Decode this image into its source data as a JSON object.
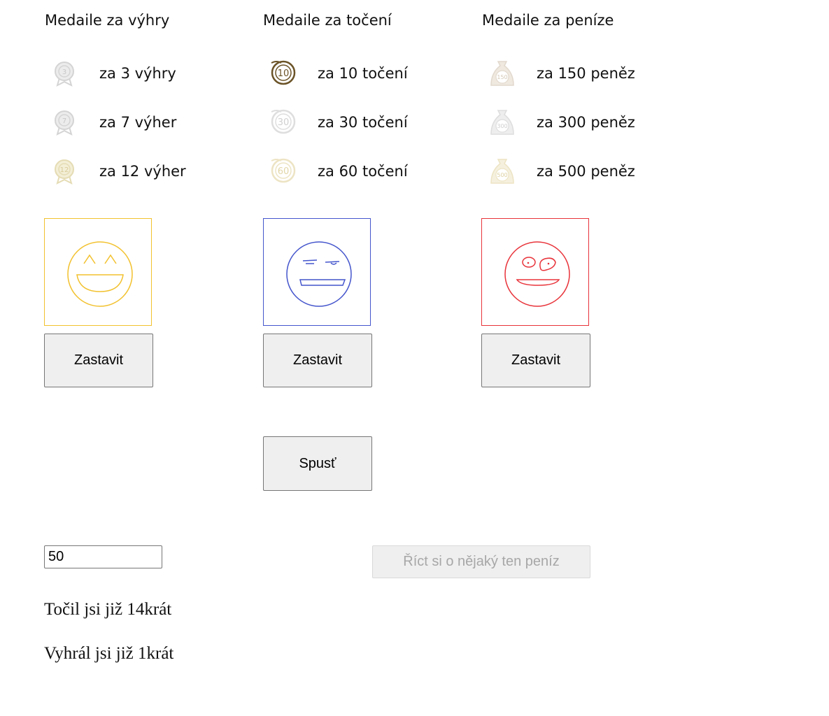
{
  "columns": [
    {
      "title": "Medaile za výhry",
      "medals": [
        {
          "badge": "3",
          "label": "za 3 výhry",
          "icon": "ribbon-medal-icon",
          "color": "#d4d4d4"
        },
        {
          "badge": "7",
          "label": "za 7 výher",
          "icon": "ribbon-medal-icon",
          "color": "#d4d4d4"
        },
        {
          "badge": "12",
          "label": "za 12 výher",
          "icon": "ribbon-medal-icon",
          "color": "#e5dcb4"
        }
      ]
    },
    {
      "title": "Medaile za točení",
      "medals": [
        {
          "badge": "10",
          "label": "za 10 točení",
          "icon": "spin-medal-icon",
          "color": "#6b5327"
        },
        {
          "badge": "30",
          "label": "za 30 točení",
          "icon": "spin-medal-icon",
          "color": "#dedede"
        },
        {
          "badge": "60",
          "label": "za 60 točení",
          "icon": "spin-medal-icon",
          "color": "#ede4c4"
        }
      ]
    },
    {
      "title": "Medaile za peníze",
      "medals": [
        {
          "badge": "150",
          "label": "za 150 peněz",
          "icon": "money-bag-medal-icon",
          "color": "#e2d9cd"
        },
        {
          "badge": "300",
          "label": "za 300 peněz",
          "icon": "money-bag-medal-icon",
          "color": "#dddddd"
        },
        {
          "badge": "500",
          "label": "za 500 peněz",
          "icon": "money-bag-medal-icon",
          "color": "#ede4c4"
        }
      ]
    }
  ],
  "reels": [
    {
      "face": "laughing-face-icon",
      "color": "#f2c12e",
      "stop_label": "Zastavit"
    },
    {
      "face": "smirking-face-icon",
      "color": "#4455cc",
      "stop_label": "Zastavit"
    },
    {
      "face": "goofy-face-icon",
      "color": "#e8333a",
      "stop_label": "Zastavit"
    }
  ],
  "spin_label": "Spusť",
  "amount_value": "50",
  "ask_money_label": "Říct si o nějaký ten peníz",
  "stats": {
    "spins": "Točil jsi již 14krát",
    "wins": "Vyhrál jsi již 1krát"
  }
}
